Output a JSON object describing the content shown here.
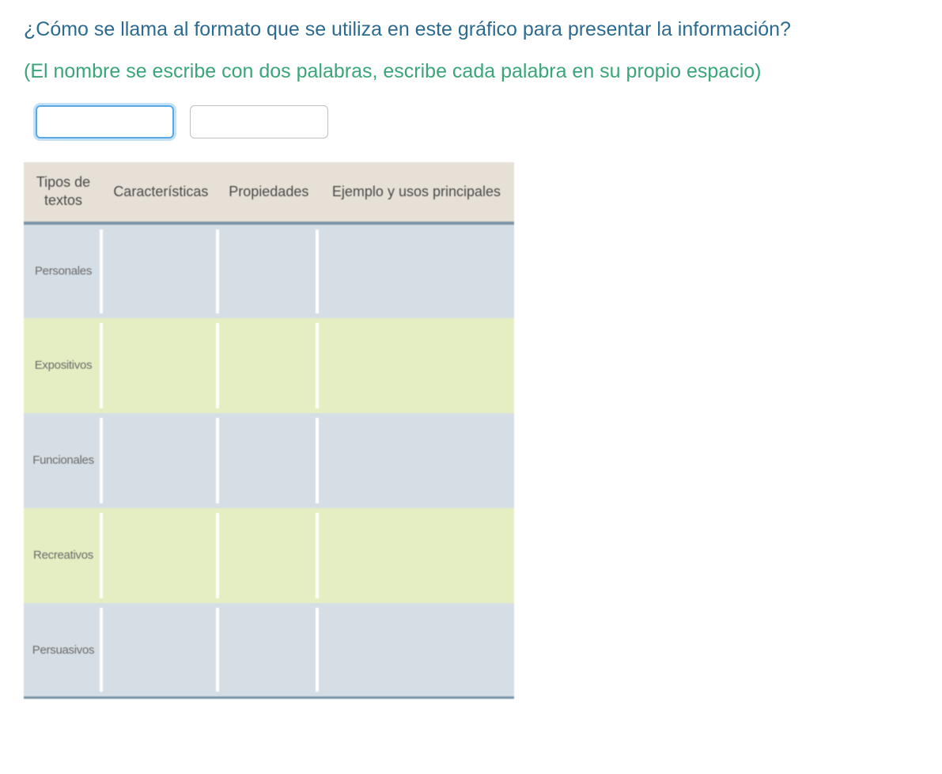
{
  "question": "¿Cómo se llama al formato que se utiliza en este gráfico para presentar la información?",
  "hint": "(El nombre se escribe con dos palabras, escribe cada palabra en su propio espacio)",
  "inputs": {
    "word1": "",
    "word2": ""
  },
  "table": {
    "headers": {
      "col1": "Tipos de textos",
      "col2": "Características",
      "col3": "Propiedades",
      "col4": "Ejemplo y usos principales"
    },
    "rows": [
      {
        "label": "Personales"
      },
      {
        "label": "Expositivos"
      },
      {
        "label": "Funcionales"
      },
      {
        "label": "Recreativos"
      },
      {
        "label": "Persuasivos"
      }
    ]
  }
}
